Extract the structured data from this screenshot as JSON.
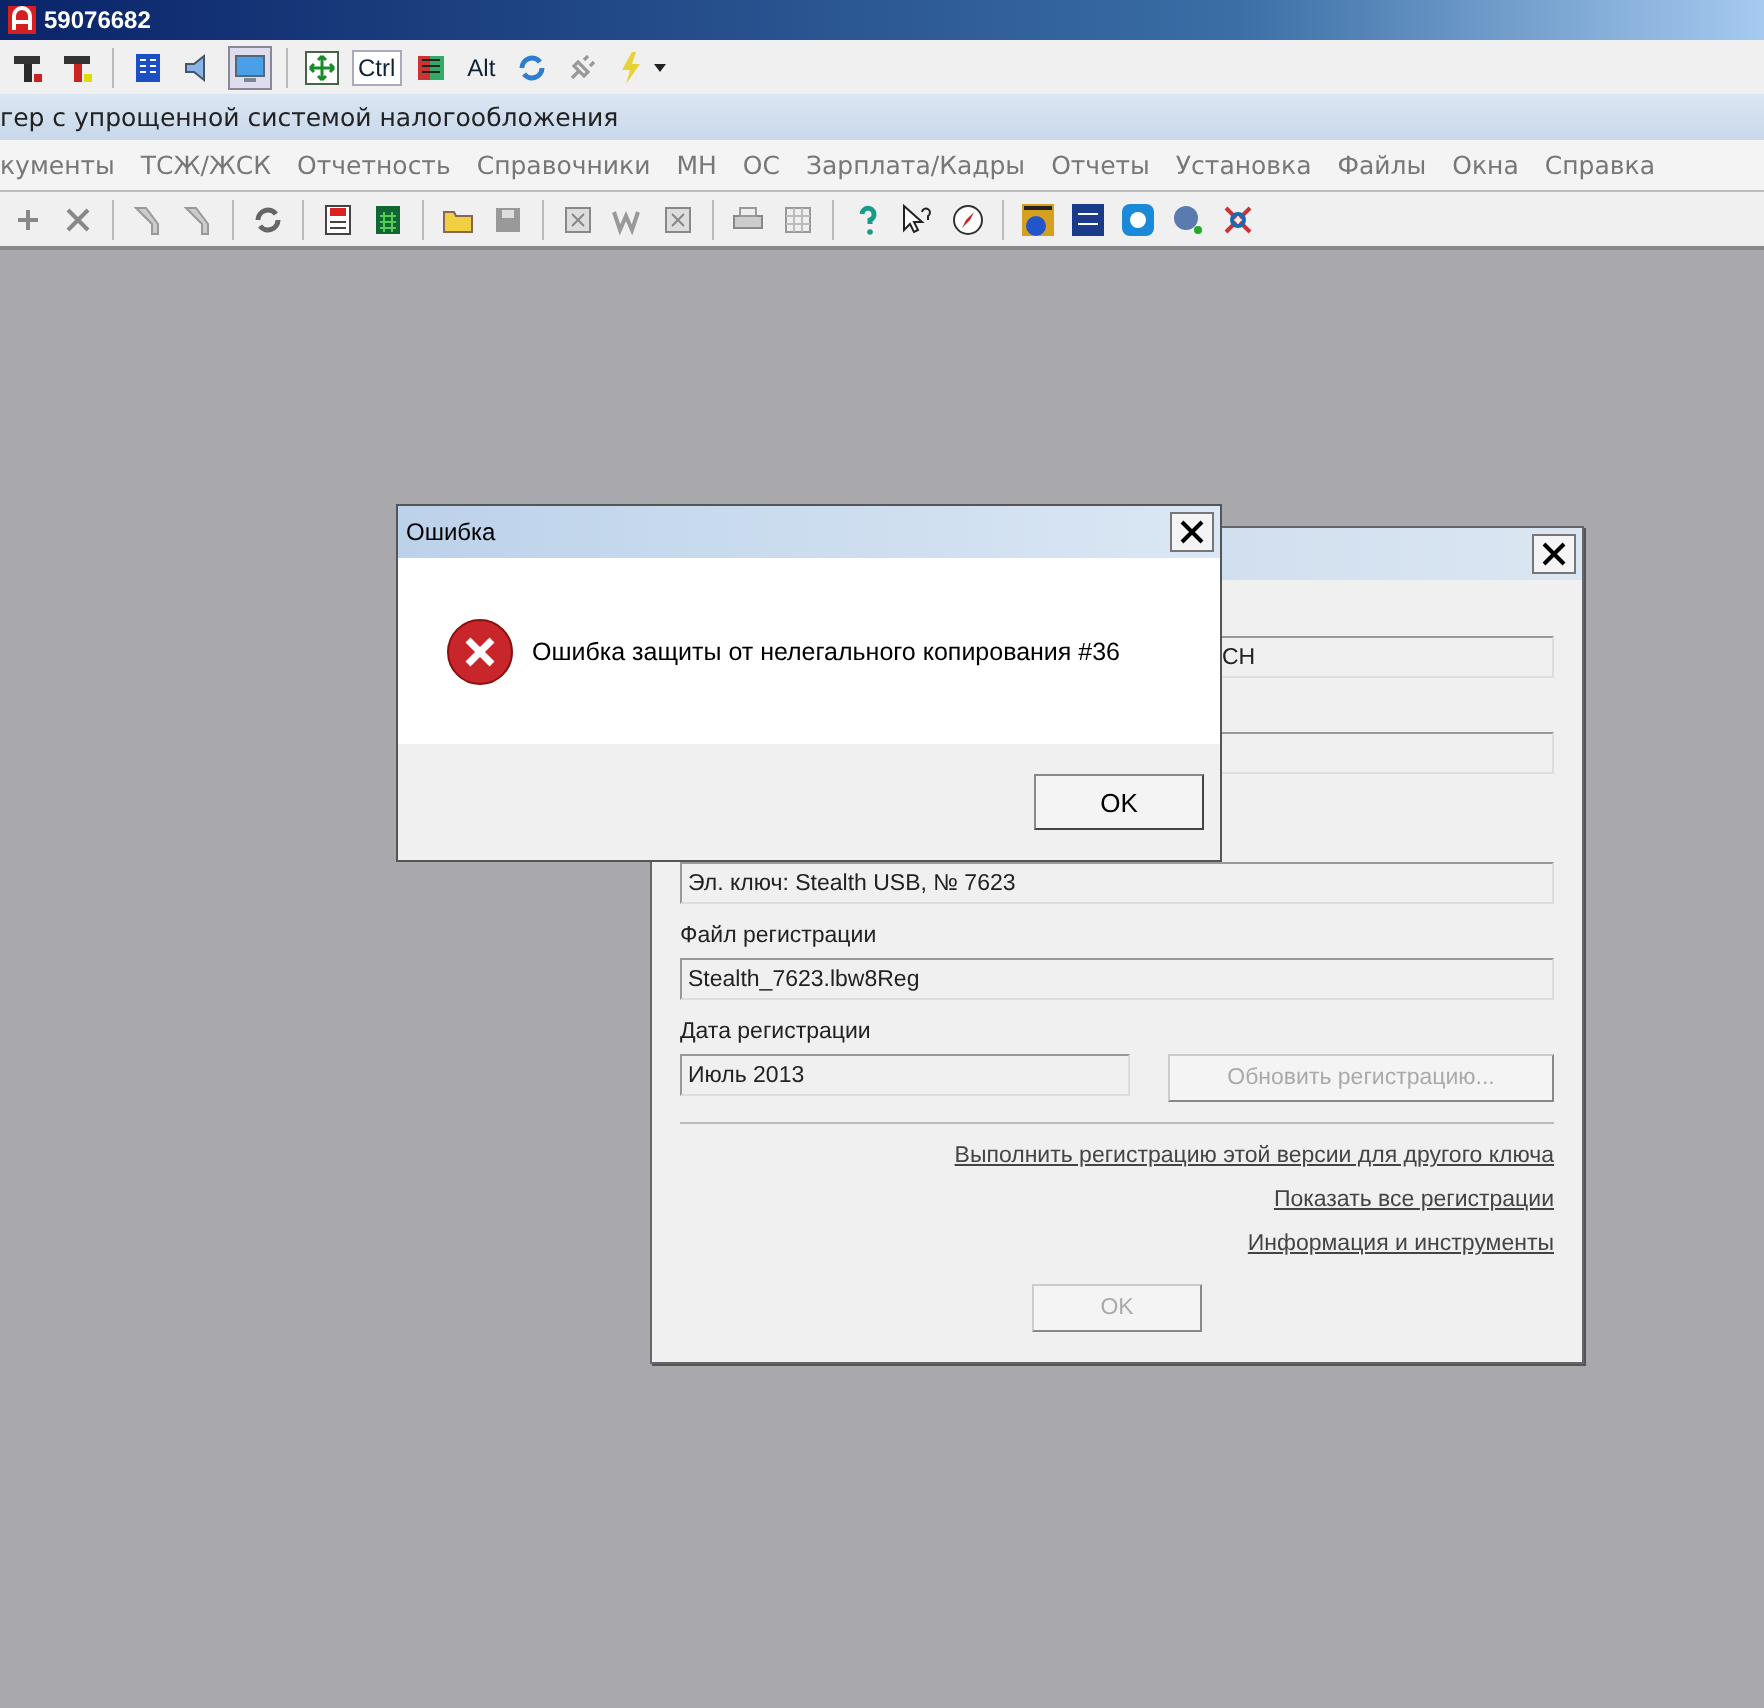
{
  "window": {
    "title": "59076682"
  },
  "quick_toolbar": {
    "text_buttons": [
      {
        "label": "Ctrl",
        "pressed": true
      },
      {
        "label": "Alt",
        "pressed": false
      }
    ]
  },
  "app_title": "гер с упрощенной системой налогообложения",
  "menu": [
    "кументы",
    "ТСЖ/ЖСК",
    "Отчетность",
    "Справочники",
    "МН",
    "ОС",
    "Зарплата/Кадры",
    "Отчеты",
    "Установка",
    "Файлы",
    "Окна",
    "Справка"
  ],
  "registration_dialog": {
    "covered_field_value": "CH",
    "fields": [
      {
        "value": "Эл. ключ: Stealth USB, № 7623"
      },
      {
        "label": "Файл регистрации",
        "value": "Stealth_7623.lbw8Reg"
      }
    ],
    "date_label": "Дата регистрации",
    "date_value": "Июль 2013",
    "update_button": {
      "label": "Обновить регистрацию...",
      "disabled": true
    },
    "links": [
      "Выполнить регистрацию этой версии для другого ключа",
      "Показать все регистрации",
      "Информация и инструменты"
    ],
    "ok_button": {
      "label": "OK",
      "disabled": true
    }
  },
  "error_dialog": {
    "title": "Ошибка",
    "message": "Ошибка защиты от нелегального копирования #36",
    "ok_button": "OK"
  }
}
